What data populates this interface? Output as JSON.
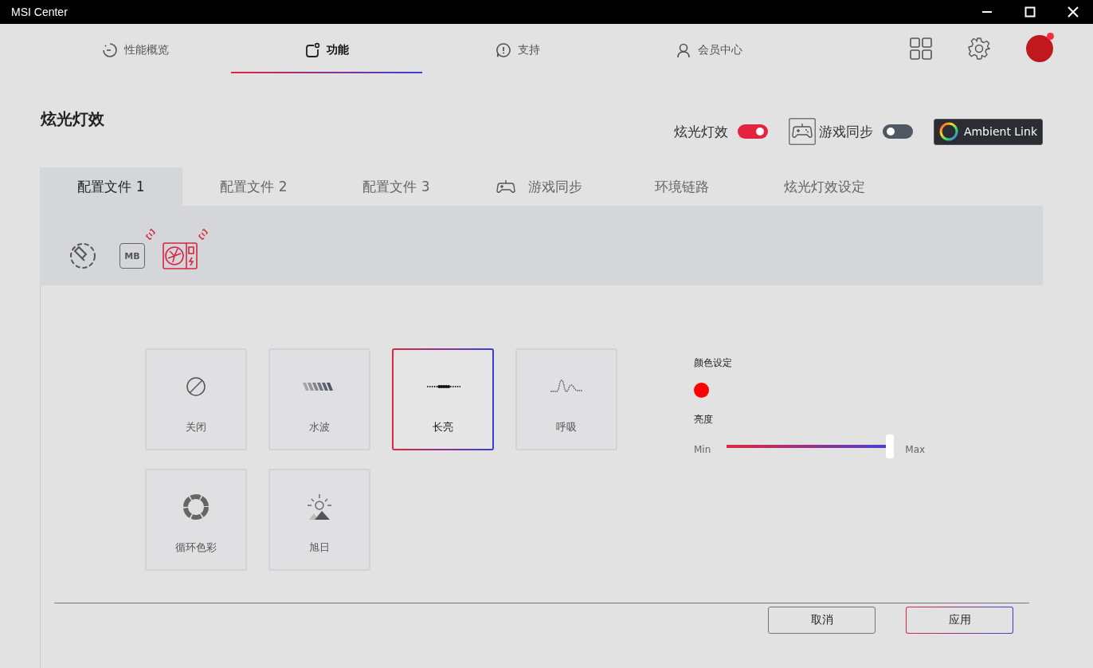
{
  "window": {
    "title": "MSI Center"
  },
  "nav": [
    {
      "label": "性能概览",
      "kind": "gauge",
      "selected": false
    },
    {
      "label": "功能",
      "kind": "feature",
      "selected": true
    },
    {
      "label": "支持",
      "kind": "support",
      "selected": false
    },
    {
      "label": "会员中心",
      "kind": "user",
      "selected": false
    }
  ],
  "avatar": {
    "notification": true
  },
  "section": {
    "title": "炫光灯效"
  },
  "switches": [
    {
      "label": "炫光灯效",
      "kind": "plain",
      "on": true
    },
    {
      "label": "游戏同步",
      "kind": "gamepad",
      "on": false
    }
  ],
  "ambient_button": {
    "label": "Ambient Link"
  },
  "tabs": [
    {
      "label": "配置文件 1",
      "kind": "plain",
      "selected": true
    },
    {
      "label": "配置文件 2",
      "kind": "plain",
      "selected": false
    },
    {
      "label": "配置文件 3",
      "kind": "plain",
      "selected": false
    },
    {
      "label": "游戏同步",
      "kind": "gamepad",
      "selected": false
    },
    {
      "label": "环境链路",
      "kind": "plain",
      "selected": false
    },
    {
      "label": "炫光灯效设定",
      "kind": "plain",
      "selected": false
    }
  ],
  "devices": [
    {
      "kind": "sync",
      "selected": false,
      "linked": false
    },
    {
      "kind": "board",
      "label": "MB",
      "selected": false,
      "linked": true
    },
    {
      "kind": "gpu",
      "selected": true,
      "linked": true
    }
  ],
  "effects": [
    {
      "label": "关闭",
      "kind": "off",
      "selected": false
    },
    {
      "label": "水波",
      "kind": "wave",
      "selected": false
    },
    {
      "label": "长亮",
      "kind": "steady",
      "selected": true
    },
    {
      "label": "呼吸",
      "kind": "breath",
      "selected": false
    },
    {
      "label": "循环色彩",
      "kind": "cycle",
      "selected": false
    },
    {
      "label": "旭日",
      "kind": "sunrise",
      "selected": false
    }
  ],
  "color_setting": {
    "label": "颜色设定",
    "color": "#ff0000"
  },
  "brightness": {
    "label": "亮度",
    "min_label": "Min",
    "max_label": "Max",
    "level": 0.98
  },
  "buttons": [
    {
      "label": "取消",
      "kind": "cancel"
    },
    {
      "label": "应用",
      "kind": "apply"
    }
  ]
}
